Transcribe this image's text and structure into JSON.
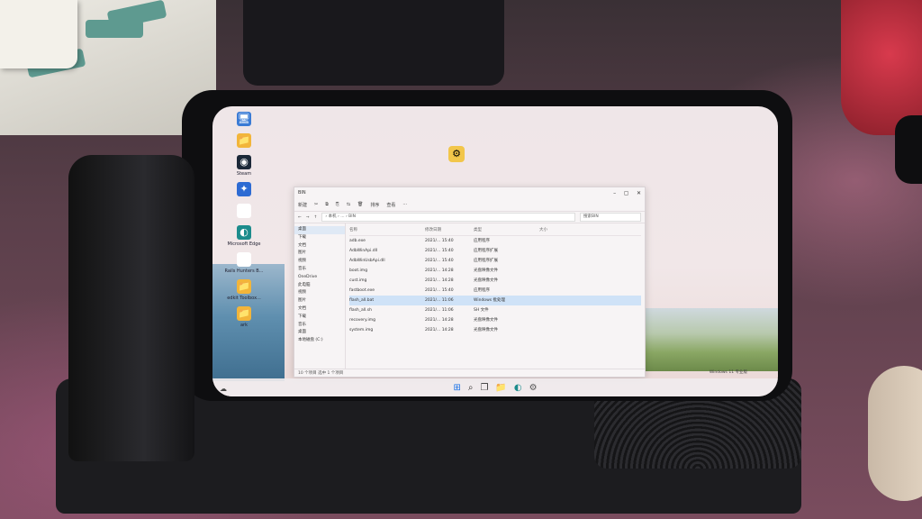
{
  "desktop": {
    "icons": [
      {
        "name": "This PC",
        "glyph": "🖥",
        "color": "#3a7bd5",
        "label": ""
      },
      {
        "name": "folder",
        "glyph": "📁",
        "color": "#f2b53a",
        "label": ""
      },
      {
        "name": "Steam",
        "glyph": "◉",
        "color": "#1b2838",
        "label": "Steam"
      },
      {
        "name": "app",
        "glyph": "✦",
        "color": "#2d6bd3",
        "label": ""
      },
      {
        "name": "file",
        "glyph": "▤",
        "color": "#ffffff",
        "label": ""
      },
      {
        "name": "Edge",
        "glyph": "◐",
        "color": "#1c8c8c",
        "label": "Microsoft Edge"
      },
      {
        "name": "doc",
        "glyph": "▤",
        "color": "#ffffff",
        "label": "Rails Hunters B..."
      },
      {
        "name": "folder2",
        "glyph": "📁",
        "color": "#f2b53a",
        "label": "edkit Toolbox..."
      },
      {
        "name": "folder3",
        "glyph": "📁",
        "color": "#f2b53a",
        "label": "ark"
      }
    ],
    "center_icon": {
      "glyph": "⚙",
      "label": ""
    }
  },
  "explorer": {
    "title": "BIN",
    "address_path": "› 本机 › ... › BIN",
    "search_placeholder": "搜索BIN",
    "toolbar": [
      "新建",
      "✂",
      "⧉",
      "⎘",
      "⇆",
      "🗑",
      "排序",
      "查看",
      "···"
    ],
    "nav": [
      {
        "label": "桌面",
        "sel": true
      },
      {
        "label": "下载",
        "sel": false
      },
      {
        "label": "文档",
        "sel": false
      },
      {
        "label": "图片",
        "sel": false
      },
      {
        "label": "视频",
        "sel": false
      },
      {
        "label": "音乐",
        "sel": false
      },
      {
        "label": "OneDrive",
        "sel": false
      },
      {
        "label": "此电脑",
        "sel": false
      },
      {
        "label": "视频",
        "sel": false
      },
      {
        "label": "图片",
        "sel": false
      },
      {
        "label": "文档",
        "sel": false
      },
      {
        "label": "下载",
        "sel": false
      },
      {
        "label": "音乐",
        "sel": false
      },
      {
        "label": "桌面",
        "sel": false
      },
      {
        "label": "本地磁盘 (C:)",
        "sel": false
      }
    ],
    "columns": [
      "名称",
      "修改日期",
      "类型",
      "大小"
    ],
    "files": [
      {
        "name": "adb.exe",
        "date": "2021/... 15:40",
        "type": "应用程序",
        "size": "",
        "sel": false
      },
      {
        "name": "AdbWinApi.dll",
        "date": "2021/... 15:40",
        "type": "应用程序扩展",
        "size": "",
        "sel": false
      },
      {
        "name": "AdbWinUsbApi.dll",
        "date": "2021/... 15:40",
        "type": "应用程序扩展",
        "size": "",
        "sel": false
      },
      {
        "name": "boot.img",
        "date": "2021/... 14:28",
        "type": "光盘映像文件",
        "size": "",
        "sel": false
      },
      {
        "name": "cust.img",
        "date": "2021/... 14:28",
        "type": "光盘映像文件",
        "size": "",
        "sel": false
      },
      {
        "name": "fastboot.exe",
        "date": "2021/... 15:40",
        "type": "应用程序",
        "size": "",
        "sel": false
      },
      {
        "name": "flash_all.bat",
        "date": "2021/... 11:06",
        "type": "Windows 批处理",
        "size": "",
        "sel": true
      },
      {
        "name": "flash_all.sh",
        "date": "2021/... 11:06",
        "type": "SH 文件",
        "size": "",
        "sel": false
      },
      {
        "name": "recovery.img",
        "date": "2021/... 14:28",
        "type": "光盘映像文件",
        "size": "",
        "sel": false
      },
      {
        "name": "system.img",
        "date": "2021/... 14:28",
        "type": "光盘映像文件",
        "size": "",
        "sel": false
      }
    ],
    "status": "10 个项目   选中 1 个项目"
  },
  "taskbar": {
    "apps": [
      {
        "name": "start",
        "glyph": "⊞",
        "color": "#1a73e8"
      },
      {
        "name": "search",
        "glyph": "⌕",
        "color": "#333333"
      },
      {
        "name": "taskview",
        "glyph": "❐",
        "color": "#333333"
      },
      {
        "name": "explorer",
        "glyph": "📁",
        "color": "#f2b53a"
      },
      {
        "name": "edge",
        "glyph": "◐",
        "color": "#1c8c8c"
      },
      {
        "name": "settings",
        "glyph": "⚙",
        "color": "#555555"
      }
    ],
    "clock": ""
  },
  "watermark": {
    "line1": "Windows 11 专业版",
    "line2": ""
  }
}
